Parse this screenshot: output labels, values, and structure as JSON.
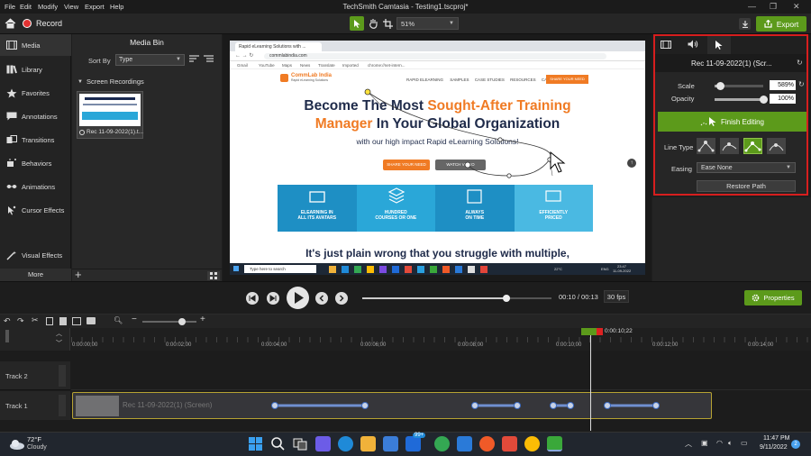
{
  "menu": [
    "File",
    "Edit",
    "Modify",
    "View",
    "Export",
    "Help"
  ],
  "window_title": "TechSmith Camtasia - Testing1.tscproj*",
  "toolbar": {
    "record_label": "Record",
    "zoom": "51%",
    "export_label": "Export"
  },
  "left_nav": [
    {
      "label": "Media",
      "icon": "film-icon"
    },
    {
      "label": "Library",
      "icon": "library-icon"
    },
    {
      "label": "Favorites",
      "icon": "star-icon"
    },
    {
      "label": "Annotations",
      "icon": "annotation-icon"
    },
    {
      "label": "Transitions",
      "icon": "transitions-icon"
    },
    {
      "label": "Behaviors",
      "icon": "behaviors-icon"
    },
    {
      "label": "Animations",
      "icon": "animations-icon"
    },
    {
      "label": "Cursor Effects",
      "icon": "cursor-icon"
    },
    {
      "label": "Visual Effects",
      "icon": "visual-effects-icon"
    }
  ],
  "more_label": "More",
  "media_bin": {
    "title": "Media Bin",
    "sort_by": "Sort By",
    "sort_value": "Type",
    "group": "Screen Recordings",
    "clip_name": "Rec 11-09-2022(1).t..."
  },
  "browser": {
    "tab_title": "Rapid eLearning Solutions with ...",
    "url": "commlabindia.com",
    "bookmarks": [
      "Gmail",
      "YouTube",
      "Maps",
      "News",
      "Translate",
      "Imported",
      "chrome://net-intern..."
    ],
    "logo_name": "CommLab India",
    "logo_sub": "Rapid eLearning Solutions",
    "nav": [
      "RAPID ELEARNING",
      "SAMPLES",
      "CASE STUDIES",
      "RESOURCES",
      "CAREERS"
    ],
    "nav_cta": "SHARE YOUR NEED",
    "hero_line1_a": "Become The Most ",
    "hero_line1_b": "Sought-After Training",
    "hero_line2_a": "Manager",
    "hero_line2_b": " In Your Global Organization",
    "hero_sub": "with our high impact Rapid eLearning Solutions!",
    "btn_share": "SHARE YOUR NEED",
    "btn_watch": "WATCH VIDEO",
    "tiles": [
      {
        "l1": "ELEARNING IN",
        "l2": "ALL ITS AVATARS"
      },
      {
        "l1": "HUNDRED",
        "l2": "COURSES OR ONE"
      },
      {
        "l1": "ALWAYS",
        "l2": "ON TIME"
      },
      {
        "l1": "EFFICIENTLY",
        "l2": "PRICED"
      }
    ],
    "bottom_text": "It's just plain wrong that you struggle with multiple,",
    "win_search": "Type here to search",
    "win_temp": "22°C",
    "win_lang": "ENG",
    "win_time": "23:47",
    "win_date": "11-09-2022"
  },
  "properties": {
    "clip_title": "Rec 11-09-2022(1) (Scr...",
    "scale_label": "Scale",
    "scale_value": "589%",
    "scale_level": 0.12,
    "opacity_label": "Opacity",
    "opacity_value": "100%",
    "opacity_level": 1.0,
    "finish_label": "Finish Editing",
    "line_type_label": "Line Type",
    "easing_label": "Easing",
    "easing_value": "Ease None",
    "restore_label": "Restore Path"
  },
  "transport": {
    "time_current": "00:10",
    "time_total": "00:13",
    "fps": "30 fps",
    "properties_label": "Properties",
    "progress": 0.76
  },
  "timeline": {
    "playhead": "0:00:10;22",
    "ticks": [
      "0:00:00;00",
      "0:00:02;00",
      "0:00:04;00",
      "0:00:06;00",
      "0:00:08;00",
      "0:00:10;00",
      "0:00:12;00",
      "0:00:14;00"
    ],
    "tracks": [
      "Track 2",
      "Track 1"
    ],
    "clip_label": "Rec 11-09-2022(1) (Screen)"
  },
  "taskbar": {
    "temp": "72°F",
    "weather": "Cloudy",
    "badge": "99+",
    "time": "11:47 PM",
    "date": "9/11/2022",
    "notif": "2"
  },
  "colors": {
    "accent_green": "#5c9a1b",
    "brand_orange": "#f07b24",
    "tile_blue": "#2aa7d8",
    "highlight_red": "#d71e1e"
  }
}
